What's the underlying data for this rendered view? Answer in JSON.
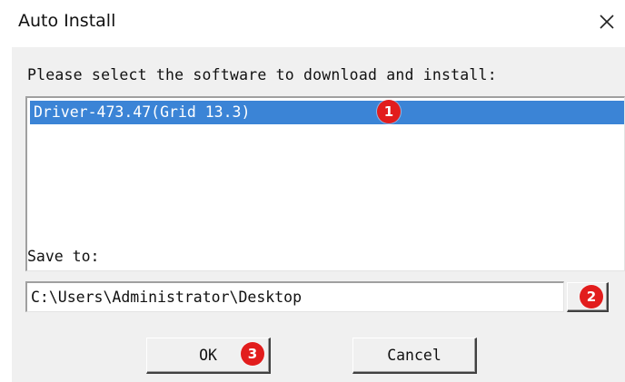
{
  "window": {
    "title": "Auto Install",
    "close_icon": "close-icon"
  },
  "prompt": "Please select the software to download and install:",
  "software_list": {
    "items": [
      {
        "label": "Driver-473.47(Grid 13.3)",
        "selected": true
      }
    ],
    "selected_color": "#3b84d6"
  },
  "save_to": {
    "label": "Save to:",
    "path": "C:\\Users\\Administrator\\Desktop",
    "browse_icon": "ellipsis-icon"
  },
  "buttons": {
    "ok_label": "OK",
    "cancel_label": "Cancel"
  },
  "markers": {
    "step1": "1",
    "step2": "2",
    "step3": "3",
    "color": "#e21d1d"
  }
}
